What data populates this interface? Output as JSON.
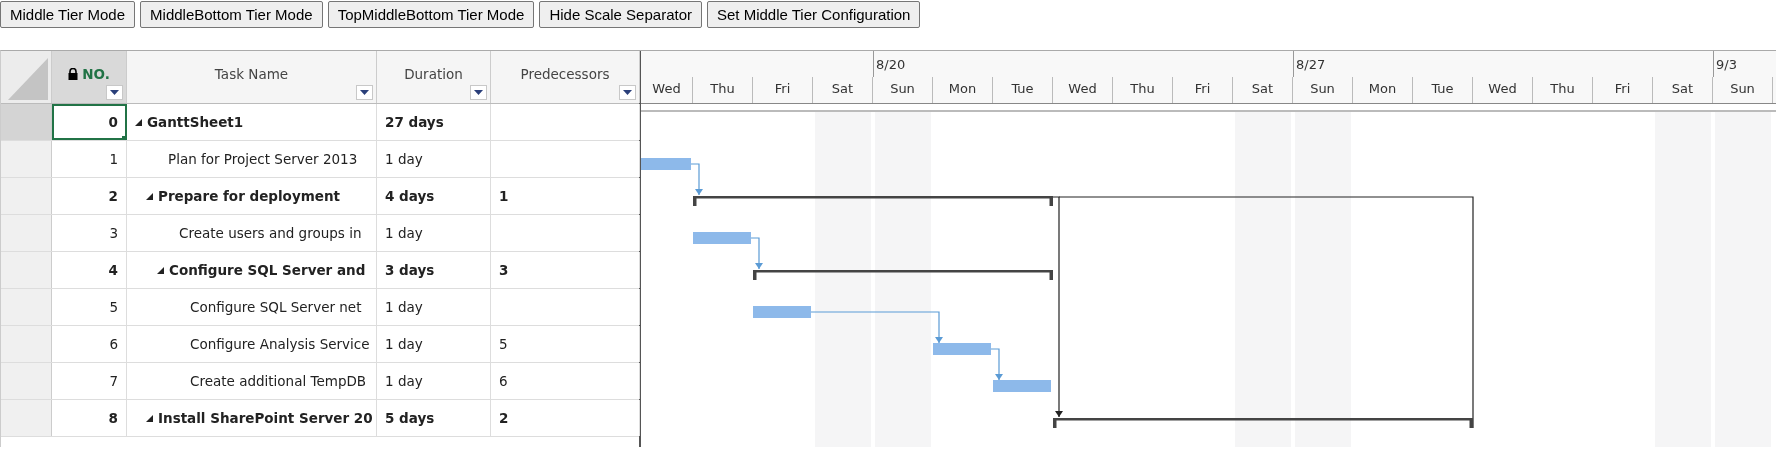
{
  "toolbar": {
    "buttons": [
      "Middle Tier Mode",
      "MiddleBottom Tier Mode",
      "TopMiddleBottom Tier Mode",
      "Hide Scale Separator",
      "Set Middle Tier Configuration"
    ]
  },
  "grid": {
    "columns": [
      {
        "label": "NO.",
        "locked": true,
        "selected": true
      },
      {
        "label": "Task Name",
        "locked": false,
        "selected": false
      },
      {
        "label": "Duration",
        "locked": false,
        "selected": false
      },
      {
        "label": "Predecessors",
        "locked": false,
        "selected": false
      }
    ],
    "tasks": [
      {
        "no": "0",
        "name": "GanttSheet1",
        "duration": "27 days",
        "selected": true,
        "expanded": true,
        "children": [
          {
            "no": "1",
            "name": "Plan for Project Server 2013",
            "duration": "1 day",
            "selected": false
          },
          {
            "no": "2",
            "name": "Prepare for deployment",
            "duration": "4 days",
            "predecessors": "1",
            "selected": false,
            "expanded": true,
            "children": [
              {
                "no": "3",
                "name": "Create users and groups in",
                "duration": "1 day",
                "selected": false
              },
              {
                "no": "4",
                "name": "Configure SQL Server and",
                "duration": "3 days",
                "predecessors": "3",
                "selected": false,
                "expanded": true,
                "children": [
                  {
                    "no": "5",
                    "name": "Configure SQL Server net",
                    "duration": "1 day",
                    "selected": false
                  },
                  {
                    "no": "6",
                    "name": "Configure Analysis Service",
                    "duration": "1 day",
                    "predecessors": "5",
                    "selected": false
                  },
                  {
                    "no": "7",
                    "name": "Create additional TempDB",
                    "duration": "1 day",
                    "predecessors": "6",
                    "selected": false
                  }
                ]
              }
            ]
          },
          {
            "no": "8",
            "name": "Install SharePoint Server 20",
            "duration": "5 days",
            "predecessors": "2",
            "selected": false,
            "expanded": true
          }
        ]
      }
    ]
  },
  "timeline": {
    "top_tier": [
      "8/20",
      "8/27",
      "9/3"
    ],
    "days": [
      "Wed",
      "Thu",
      "Fri",
      "Sat",
      "Sun",
      "Mon",
      "Tue",
      "Wed",
      "Thu",
      "Fri",
      "Sat",
      "Sun",
      "Mon",
      "Tue",
      "Wed",
      "Thu",
      "Fri",
      "Sat",
      "Sun"
    ]
  }
}
